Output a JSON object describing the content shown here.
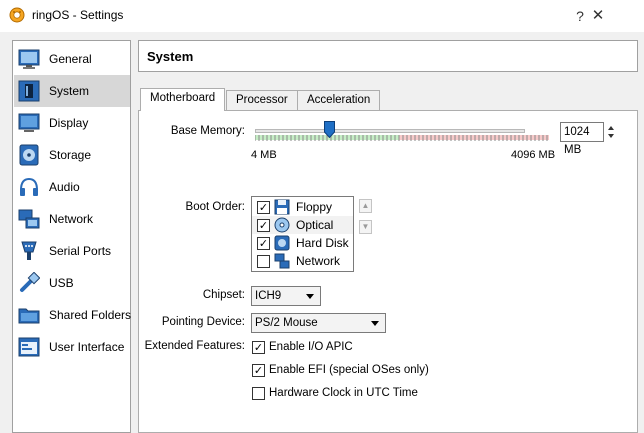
{
  "window": {
    "title": "ringOS - Settings",
    "help_label": "?",
    "close_label": "✕"
  },
  "sidebar": {
    "selected": "System",
    "items": [
      {
        "label": "General",
        "icon": "general-icon"
      },
      {
        "label": "System",
        "icon": "system-icon"
      },
      {
        "label": "Display",
        "icon": "display-icon"
      },
      {
        "label": "Storage",
        "icon": "storage-icon"
      },
      {
        "label": "Audio",
        "icon": "audio-icon"
      },
      {
        "label": "Network",
        "icon": "network-icon"
      },
      {
        "label": "Serial Ports",
        "icon": "serial-ports-icon"
      },
      {
        "label": "USB",
        "icon": "usb-icon"
      },
      {
        "label": "Shared Folders",
        "icon": "shared-folders-icon"
      },
      {
        "label": "User Interface",
        "icon": "user-interface-icon"
      }
    ]
  },
  "page": {
    "title": "System",
    "tabs": [
      {
        "label": "Motherboard",
        "active": true
      },
      {
        "label": "Processor",
        "active": false
      },
      {
        "label": "Acceleration",
        "active": false
      }
    ]
  },
  "motherboard": {
    "base_memory": {
      "label": "Base Memory:",
      "value": "1024 MB",
      "min_label": "4 MB",
      "max_label": "4096 MB",
      "slider_fraction": 0.25
    },
    "boot_order": {
      "label": "Boot Order:",
      "items": [
        {
          "label": "Floppy",
          "checked": true,
          "icon": "floppy-icon"
        },
        {
          "label": "Optical",
          "checked": true,
          "icon": "optical-icon"
        },
        {
          "label": "Hard Disk",
          "checked": true,
          "icon": "hard-disk-icon"
        },
        {
          "label": "Network",
          "checked": false,
          "icon": "network-icon"
        }
      ],
      "selected": "Optical"
    },
    "chipset": {
      "label": "Chipset:",
      "value": "ICH9"
    },
    "pointing_device": {
      "label": "Pointing Device:",
      "value": "PS/2 Mouse"
    },
    "extended_features": {
      "label": "Extended Features:",
      "items": [
        {
          "label": "Enable I/O APIC",
          "checked": true
        },
        {
          "label": "Enable EFI (special OSes only)",
          "checked": true
        },
        {
          "label": "Hardware Clock in UTC Time",
          "checked": false
        }
      ]
    }
  },
  "colors": {
    "selection": "#d7d7d7",
    "slider_safe": "#c6eec6",
    "slider_danger": "#f7caca",
    "slider_thumb": "#1f6fc5"
  }
}
